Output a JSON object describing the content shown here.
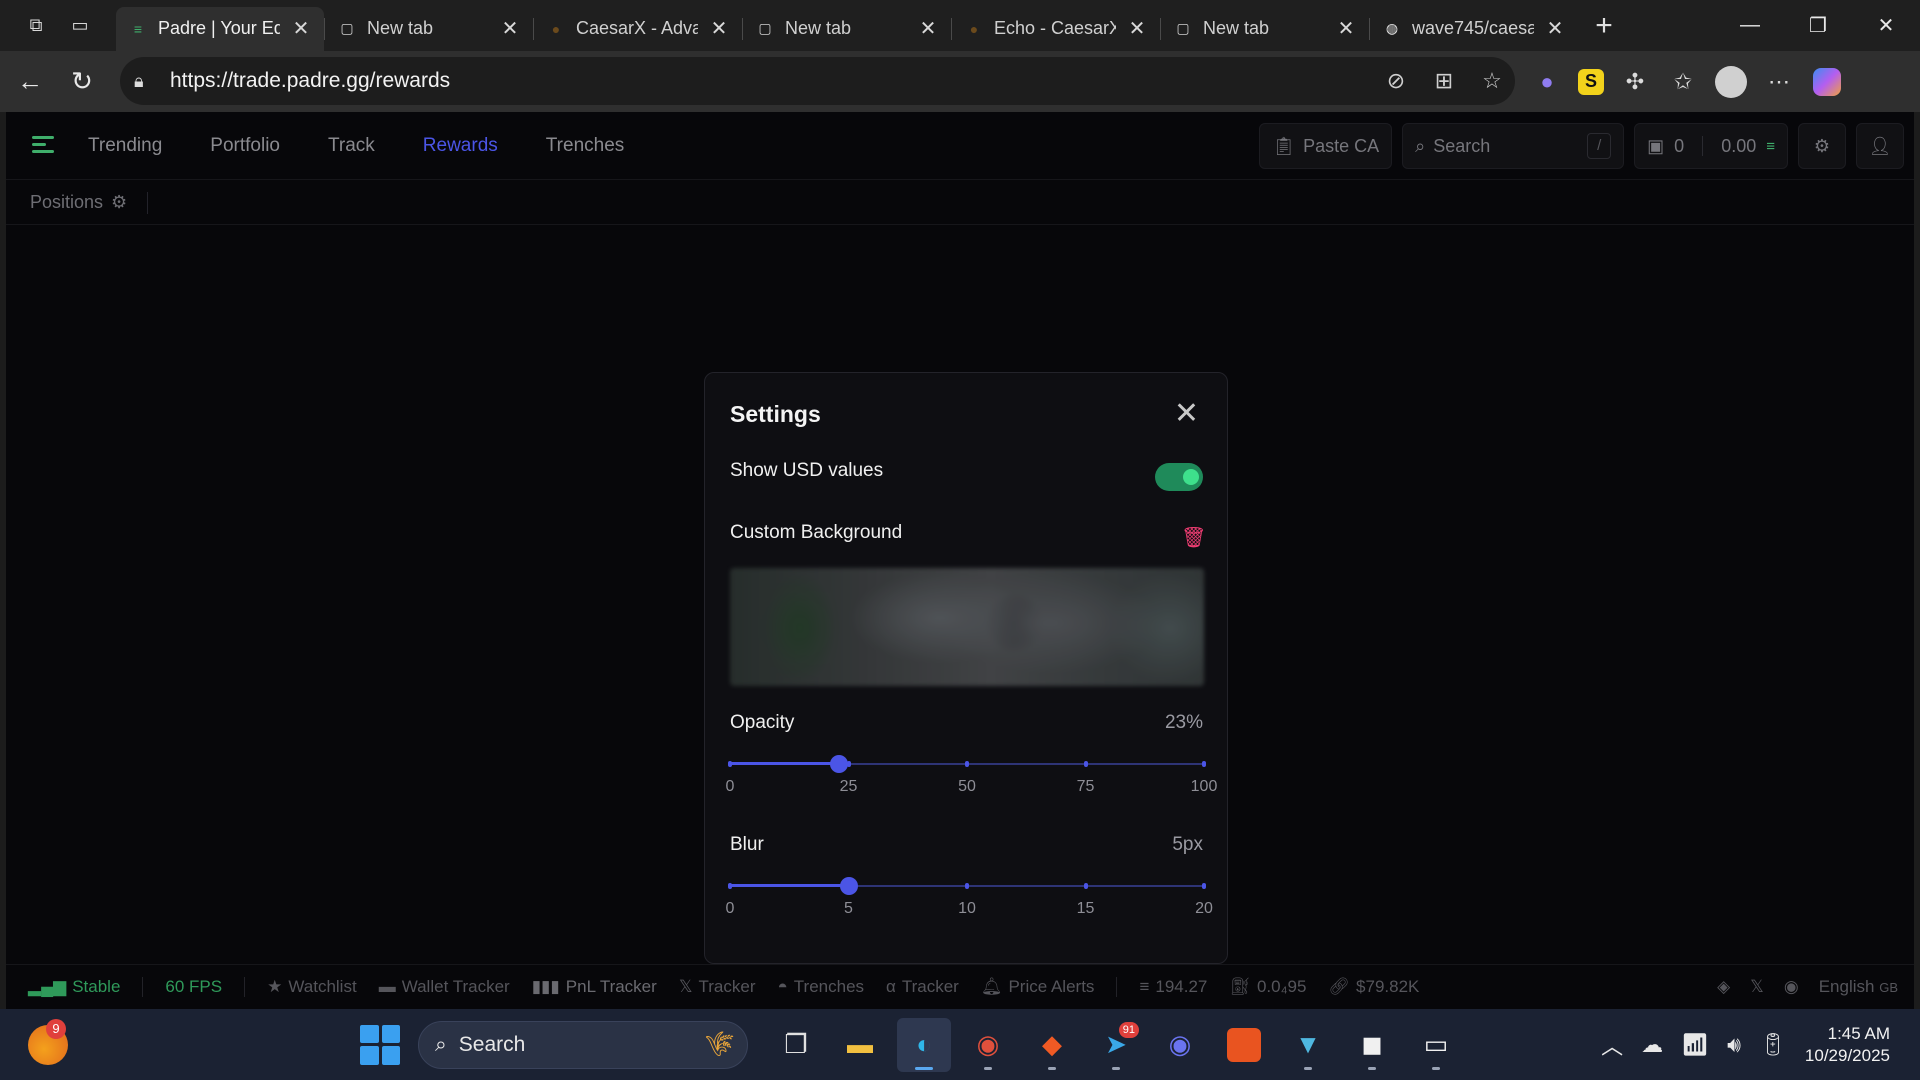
{
  "browser": {
    "tabs": [
      {
        "title": "Padre | Your Ed",
        "active": true,
        "icon": "padre-logo-icon"
      },
      {
        "title": "New tab",
        "active": false,
        "icon": "new-tab-page-icon"
      },
      {
        "title": "CaesarX - Adva",
        "active": false,
        "icon": "caesarx-coin-icon"
      },
      {
        "title": "New tab",
        "active": false,
        "icon": "new-tab-page-icon"
      },
      {
        "title": "Echo - CaesarX",
        "active": false,
        "icon": "caesarx-coin-icon"
      },
      {
        "title": "New tab",
        "active": false,
        "icon": "new-tab-page-icon"
      },
      {
        "title": "wave745/caesa",
        "active": false,
        "icon": "github-icon"
      }
    ],
    "url": "https://trade.padre.gg/rewards"
  },
  "app": {
    "nav": {
      "items": [
        "Trending",
        "Portfolio",
        "Track",
        "Rewards",
        "Trenches"
      ],
      "active": "Rewards"
    },
    "paste_ca": "Paste CA",
    "search_placeholder": "Search",
    "search_shortcut": "/",
    "wallet_count": "0",
    "balance": "0.00",
    "subnav_positions": "Positions"
  },
  "settings": {
    "title": "Settings",
    "show_usd_label": "Show USD values",
    "show_usd_enabled": true,
    "custom_bg_label": "Custom Background",
    "opacity_label": "Opacity",
    "opacity_value": "23%",
    "opacity_fraction": 0.23,
    "opacity_ticks": [
      "0",
      "25",
      "50",
      "75",
      "100"
    ],
    "blur_label": "Blur",
    "blur_value": "5px",
    "blur_fraction": 0.25,
    "blur_ticks": [
      "0",
      "5",
      "10",
      "15",
      "20"
    ],
    "accent": "#4b55e6",
    "toggle_color": "#1f8a5a",
    "delete_color": "#ee3d72"
  },
  "footer": {
    "status": "Stable",
    "fps": "60 FPS",
    "items": [
      "Watchlist",
      "Wallet Tracker",
      "PnL Tracker",
      "Tracker",
      "Trenches",
      "Tracker",
      "Price Alerts"
    ],
    "sol_price": "194.27",
    "gas": "0.0₄95",
    "market": "$79.82K",
    "language": "English",
    "language_region": "GB"
  },
  "taskbar": {
    "widget_badge": "9",
    "search_label": "Search",
    "telegram_count": "91",
    "time": "1:45 AM",
    "date": "10/29/2025"
  }
}
